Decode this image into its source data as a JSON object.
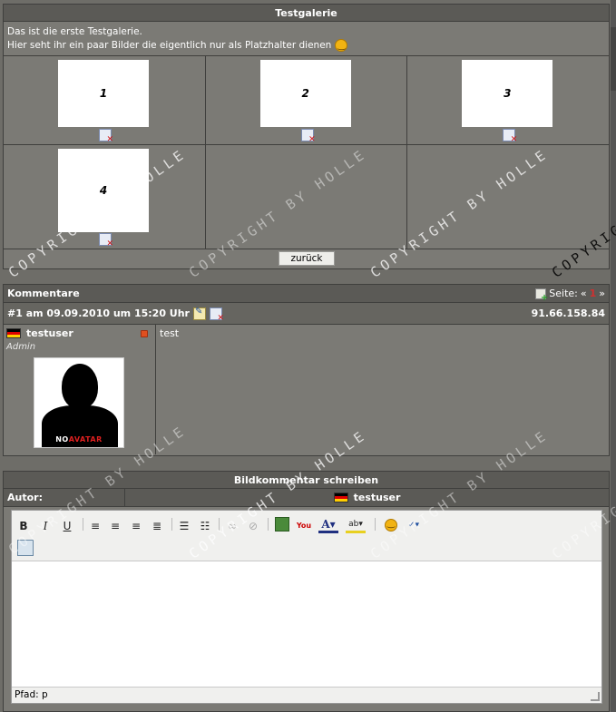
{
  "gallery": {
    "title": "Testgalerie",
    "intro_line1": "Das ist die erste Testgalerie.",
    "intro_line2": "Hier seht ihr ein paar Bilder die eigentlich nur als Platzhalter dienen",
    "images": [
      {
        "label": "1"
      },
      {
        "label": "2"
      },
      {
        "label": "3"
      },
      {
        "label": "4"
      }
    ],
    "back_label": "zurück"
  },
  "comments": {
    "title": "Kommentare",
    "pager_label": "Seite:",
    "pager_prev": "«",
    "pager_current": "1",
    "pager_next": "»",
    "entry": {
      "header": "#1 am 09.09.2010 um 15:20 Uhr",
      "ip": "91.66.158.84",
      "username": "testuser",
      "role": "Admin",
      "avatar_text_a": "NO",
      "avatar_text_b": "AVATAR",
      "text": "test"
    }
  },
  "write": {
    "title": "Bildkommentar schreiben",
    "author_label": "Autor:",
    "author_value": "testuser",
    "path_label": "Pfad: p"
  },
  "watermark": "COPYRIGHT BY HOLLE",
  "colors": {
    "panel": "#7b7a75",
    "header": "#5b5a56",
    "border": "#3f3f3d"
  }
}
